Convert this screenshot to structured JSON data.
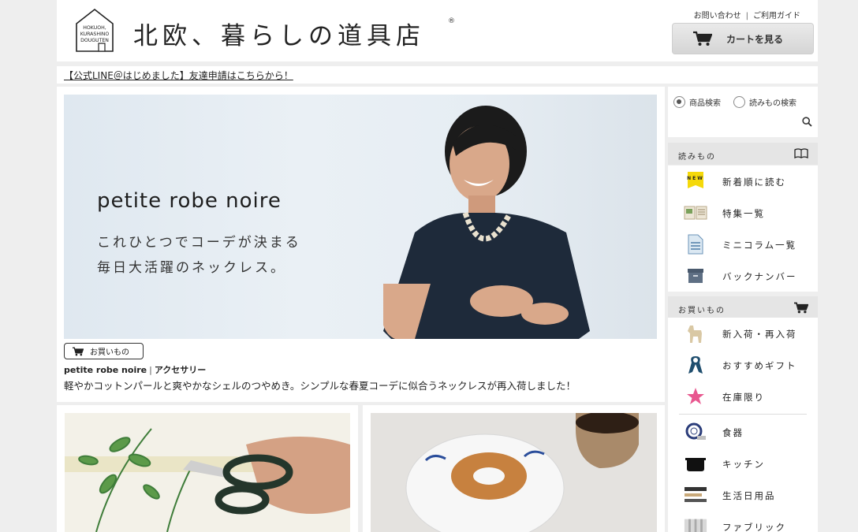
{
  "header": {
    "logo_lines": [
      "HOKUOH,",
      "KURASHINO",
      "DOUGUTEN"
    ],
    "site_title": "北欧、暮らしの道具店",
    "registered": "®",
    "contact_label": "お問い合わせ",
    "separator": "|",
    "guide_label": "ご利用ガイド",
    "cart_label": "カートを見る"
  },
  "notice": {
    "text": "【公式LINE＠はじめました】友達申請はこちらから！"
  },
  "feature": {
    "hero_title": "petite robe noire",
    "hero_sub_1": "これひとつでコーデが決まる",
    "hero_sub_2": "毎日大活躍のネックレス。",
    "tag_label": "お買いもの",
    "brand": "petite robe noire",
    "brand_sep": "|",
    "category": "アクセサリー",
    "description": "軽やかコットンパールと爽やかなシェルのつやめき。シンプルな春夏コーデに似合うネックレスが再入荷しました！"
  },
  "sidebar": {
    "search": {
      "radio_products": "商品検索",
      "radio_articles": "読みもの検索",
      "placeholder": ""
    },
    "reading": {
      "heading": "読みもの",
      "items": [
        {
          "label": "新着順に読む",
          "icon": "new-badge-icon",
          "badge": "NEW"
        },
        {
          "label": "特集一覧",
          "icon": "magazine-icon"
        },
        {
          "label": "ミニコラム一覧",
          "icon": "document-icon"
        },
        {
          "label": "バックナンバー",
          "icon": "archive-box-icon"
        }
      ]
    },
    "shopping": {
      "heading": "お買いもの",
      "items": [
        {
          "label": "新入荷・再入荷",
          "icon": "dala-horse-icon"
        },
        {
          "label": "おすすめギフト",
          "icon": "ribbon-icon"
        },
        {
          "label": "在庫限り",
          "icon": "star-icon"
        },
        {
          "label": "食器",
          "icon": "tableware-icon"
        },
        {
          "label": "キッチン",
          "icon": "pot-icon"
        },
        {
          "label": "生活日用品",
          "icon": "daily-goods-icon"
        },
        {
          "label": "ファブリック",
          "icon": "fabric-icon"
        }
      ]
    }
  },
  "colors": {
    "page_bg": "#eeeeee",
    "panel_bg": "#ffffff",
    "section_head_bg": "#e5e5e5",
    "new_badge": "#f5d90a",
    "ribbon": "#1f4e6e",
    "star": "#e8578f"
  }
}
